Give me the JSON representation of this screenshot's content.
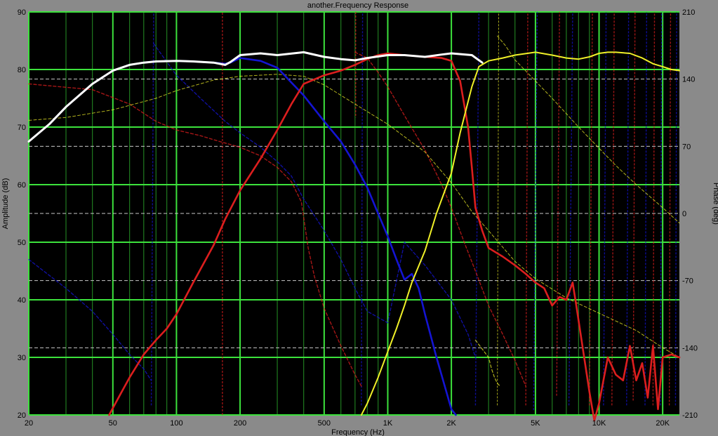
{
  "chart_data": {
    "type": "line",
    "title": "another.Frequency Response",
    "xlabel": "Frequency (Hz)",
    "ylabel": "Amplitude (dB)",
    "y2label": "Phase (deg)",
    "xscale": "log",
    "xlim": [
      20,
      24000
    ],
    "ylim": [
      20,
      90
    ],
    "y2lim": [
      -210,
      210
    ],
    "grid": true,
    "legend": "none",
    "colors": {
      "background": "#8a8a8a",
      "plot_bg": "#000000",
      "grid_major": "#3ce23c",
      "grid_minor": "#1f7a1f",
      "phase_grid": "#c8c8c8",
      "total": "#ffffff",
      "woofer": "#1414d2",
      "mid": "#dc1e1e",
      "tweeter": "#f0f028"
    },
    "x_ticks": [
      {
        "v": 20,
        "label": "20"
      },
      {
        "v": 50,
        "label": "50"
      },
      {
        "v": 100,
        "label": "100"
      },
      {
        "v": 200,
        "label": "200"
      },
      {
        "v": 500,
        "label": "500"
      },
      {
        "v": 1000,
        "label": "1K"
      },
      {
        "v": 2000,
        "label": "2K"
      },
      {
        "v": 5000,
        "label": "5K"
      },
      {
        "v": 10000,
        "label": "10K"
      },
      {
        "v": 20000,
        "label": "20K"
      }
    ],
    "x_minor_grid": [
      30,
      40,
      60,
      70,
      80,
      90,
      300,
      400,
      600,
      700,
      800,
      900,
      3000,
      4000,
      6000,
      7000,
      8000,
      9000
    ],
    "y_ticks": [
      {
        "v": 20,
        "label": "20"
      },
      {
        "v": 30,
        "label": "30"
      },
      {
        "v": 40,
        "label": "40"
      },
      {
        "v": 50,
        "label": "50"
      },
      {
        "v": 60,
        "label": "60"
      },
      {
        "v": 70,
        "label": "70"
      },
      {
        "v": 80,
        "label": "80"
      },
      {
        "v": 90,
        "label": "90"
      }
    ],
    "y2_ticks": [
      {
        "v": -210,
        "label": "-210"
      },
      {
        "v": -140,
        "label": "-140"
      },
      {
        "v": -70,
        "label": "-70"
      },
      {
        "v": 0,
        "label": "0"
      },
      {
        "v": 70,
        "label": "70"
      },
      {
        "v": 140,
        "label": "140"
      },
      {
        "v": 210,
        "label": "210"
      }
    ],
    "series": [
      {
        "key": "woofer",
        "axis": "y",
        "style": "solid",
        "width": 2.6,
        "x": [
          20,
          25,
          30,
          40,
          50,
          60,
          70,
          80,
          100,
          120,
          150,
          170,
          180,
          200,
          250,
          300,
          400,
          500,
          600,
          700,
          800,
          900,
          1000,
          1100,
          1200,
          1300,
          1400,
          1500,
          1700,
          2000,
          2100
        ],
        "y": [
          67.5,
          70.5,
          73.5,
          77.5,
          79.8,
          80.8,
          81.2,
          81.4,
          81.5,
          81.4,
          81.2,
          81.0,
          81.2,
          82.0,
          81.5,
          80.3,
          75.5,
          71.0,
          67.5,
          63.5,
          59.5,
          55.0,
          51.0,
          47.0,
          43.5,
          44.5,
          42.0,
          37.5,
          30.0,
          21.0,
          20.0
        ]
      },
      {
        "key": "mid",
        "axis": "y",
        "style": "solid",
        "width": 2.6,
        "x": [
          48,
          55,
          60,
          70,
          80,
          90,
          100,
          120,
          150,
          170,
          200,
          250,
          300,
          350,
          400,
          500,
          600,
          700,
          800,
          900,
          1000,
          1200,
          1500,
          1800,
          2000,
          2200,
          2400,
          2500,
          2600,
          2800,
          3000,
          3500,
          4000,
          4500,
          5000,
          5500,
          6000,
          6500,
          7000,
          7500,
          7800,
          8500,
          9000,
          9500,
          10000,
          11000,
          12000,
          13000,
          14000,
          15000,
          16000,
          17000,
          18000,
          19000,
          20000,
          22000,
          24000
        ],
        "y": [
          20.0,
          24.0,
          26.5,
          30.5,
          33.0,
          35.0,
          37.5,
          43.0,
          49.5,
          54.0,
          59.0,
          64.5,
          69.5,
          74.0,
          77.5,
          79.0,
          79.8,
          80.8,
          81.8,
          82.5,
          82.8,
          82.5,
          82.2,
          82.0,
          81.5,
          78.0,
          70.0,
          63.0,
          56.0,
          52.0,
          49.0,
          47.5,
          46.0,
          44.5,
          43.0,
          42.0,
          39.0,
          40.5,
          40.0,
          43.0,
          39.0,
          30.0,
          24.0,
          19.0,
          22.0,
          30.0,
          27.0,
          26.0,
          32.0,
          26.0,
          29.0,
          23.0,
          32.0,
          21.0,
          30.0,
          30.5,
          30.0
        ]
      },
      {
        "key": "tweeter",
        "axis": "y",
        "style": "solid",
        "width": 2.0,
        "x": [
          750,
          800,
          900,
          1000,
          1100,
          1200,
          1300,
          1500,
          1700,
          2000,
          2200,
          2500,
          2700,
          3000,
          3500,
          4000,
          5000,
          6000,
          7000,
          8000,
          9000,
          10000,
          11000,
          12000,
          14000,
          16000,
          18000,
          20000,
          22000,
          24000
        ],
        "y": [
          20.0,
          22.0,
          26.5,
          31.0,
          35.0,
          39.0,
          43.0,
          48.5,
          55.0,
          62.0,
          69.0,
          77.0,
          80.5,
          81.5,
          82.0,
          82.5,
          83.0,
          82.5,
          82.0,
          81.8,
          82.2,
          82.8,
          83.0,
          83.0,
          82.8,
          82.0,
          81.0,
          80.5,
          80.0,
          79.8
        ]
      },
      {
        "key": "total",
        "axis": "y",
        "style": "solid",
        "width": 3.0,
        "x": [
          20,
          25,
          30,
          40,
          50,
          60,
          70,
          80,
          100,
          120,
          150,
          170,
          180,
          200,
          250,
          300,
          400,
          500,
          600,
          700,
          800,
          1000,
          1200,
          1500,
          1800,
          2000,
          2500,
          2800
        ],
        "y": [
          67.5,
          70.5,
          73.5,
          77.5,
          79.8,
          80.8,
          81.2,
          81.4,
          81.5,
          81.4,
          81.2,
          80.8,
          81.3,
          82.5,
          82.8,
          82.5,
          83.0,
          82.2,
          81.8,
          81.6,
          82.0,
          82.5,
          82.5,
          82.2,
          82.6,
          82.8,
          82.5,
          81.2
        ]
      },
      {
        "key": "mid",
        "axis": "y",
        "style": "dashed",
        "width": 1.4,
        "x": [
          20,
          40,
          60,
          80,
          100,
          130,
          160,
          200,
          250,
          300,
          350,
          390,
          420,
          450,
          500,
          600,
          700,
          750
        ],
        "y": [
          77.5,
          76.5,
          74.0,
          71.0,
          69.5,
          68.5,
          67.5,
          66.5,
          65.0,
          63.0,
          60.5,
          57.0,
          49.0,
          44.0,
          38.5,
          32.0,
          27.0,
          25.0
        ]
      },
      {
        "key": "mid",
        "axis": "y",
        "style": "dashed",
        "width": 1.4,
        "x": [
          700,
          800,
          900,
          1000,
          1200,
          1500,
          1800,
          2000,
          2300,
          2600,
          3000,
          3500,
          4000,
          4500
        ],
        "y": [
          83.0,
          82.0,
          79.5,
          77.0,
          72.0,
          66.0,
          60.0,
          56.0,
          50.0,
          45.0,
          39.0,
          34.0,
          29.5,
          25.0
        ]
      },
      {
        "key": "woofer",
        "axis": "y",
        "style": "dashed",
        "width": 1.4,
        "x": [
          20,
          30,
          40,
          50,
          60,
          70,
          76
        ],
        "y": [
          47.0,
          42.0,
          38.0,
          34.0,
          30.5,
          28.0,
          26.0
        ]
      },
      {
        "key": "woofer",
        "axis": "y",
        "style": "dashed",
        "width": 1.4,
        "x": [
          78,
          100,
          130,
          170,
          200,
          250,
          300,
          350,
          400,
          500,
          600,
          700,
          800,
          1000,
          1200,
          1500,
          2000,
          2400,
          2600
        ],
        "y": [
          84.5,
          79.0,
          75.0,
          71.0,
          69.0,
          66.5,
          64.0,
          61.5,
          57.5,
          52.0,
          47.0,
          42.0,
          38.0,
          36.0,
          50.0,
          46.0,
          40.0,
          34.0,
          30.0
        ]
      },
      {
        "key": "tweeter",
        "axis": "y",
        "style": "dashed",
        "width": 1.2,
        "x": [
          2600,
          3000,
          3100,
          3200,
          3300,
          3400
        ],
        "y": [
          33.0,
          30.0,
          28.0,
          26.5,
          25.5,
          25.0
        ]
      },
      {
        "key": "tweeter",
        "axis": "y2",
        "style": "dashed",
        "width": 1.0,
        "x": [
          20,
          30,
          50,
          80,
          100,
          150,
          200,
          300,
          400,
          500,
          700,
          1000,
          1500,
          2000,
          2500,
          3000,
          4000,
          5000,
          7000,
          10000,
          15000,
          20000,
          24000
        ],
        "y": [
          97,
          100,
          108,
          120,
          128,
          139,
          143,
          145,
          143,
          134,
          114,
          93,
          64,
          32,
          2,
          -18,
          -50,
          -68,
          -88,
          -104,
          -122,
          -140,
          -150
        ]
      },
      {
        "key": "tweeter",
        "axis": "y2",
        "style": "dashed",
        "width": 1.0,
        "x": [
          3300,
          3600,
          4000,
          5000,
          6000,
          7000,
          8000,
          10000,
          12000,
          15000,
          20000,
          24000
        ],
        "y": [
          185,
          175,
          160,
          138,
          120,
          104,
          90,
          68,
          50,
          30,
          6,
          -10
        ]
      }
    ],
    "wraps": [
      {
        "key": "mid",
        "axis": "y2",
        "style": "dashed",
        "width": 1.4,
        "segments": [
          [
            165,
            -210,
            165,
            210
          ],
          [
            705,
            210,
            705,
            100
          ],
          [
            4500,
            -200,
            4600,
            210
          ],
          [
            6300,
            -190,
            6500,
            210
          ],
          [
            9000,
            -200,
            9300,
            210
          ],
          [
            11500,
            -200,
            11800,
            210
          ],
          [
            14500,
            -195,
            14800,
            210
          ],
          [
            18000,
            -200,
            18300,
            210
          ],
          [
            21500,
            -200,
            21800,
            210
          ]
        ]
      },
      {
        "key": "woofer",
        "axis": "y2",
        "style": "dashed",
        "width": 1.4,
        "segments": [
          [
            76,
            -200,
            78,
            210
          ],
          [
            750,
            -200,
            760,
            210
          ],
          [
            2600,
            -200,
            2700,
            210
          ],
          [
            4900,
            -205,
            5100,
            210
          ],
          [
            7200,
            -200,
            7500,
            210
          ],
          [
            10500,
            -200,
            10800,
            210
          ],
          [
            13500,
            -200,
            13800,
            210
          ],
          [
            16500,
            -200,
            16800,
            210
          ],
          [
            19500,
            -200,
            19800,
            210
          ],
          [
            23000,
            -200,
            23300,
            210
          ]
        ]
      },
      {
        "key": "tweeter",
        "axis": "y2",
        "style": "dashed",
        "width": 1.0,
        "segments": [
          [
            3300,
            -200,
            3350,
            210
          ]
        ]
      }
    ]
  }
}
